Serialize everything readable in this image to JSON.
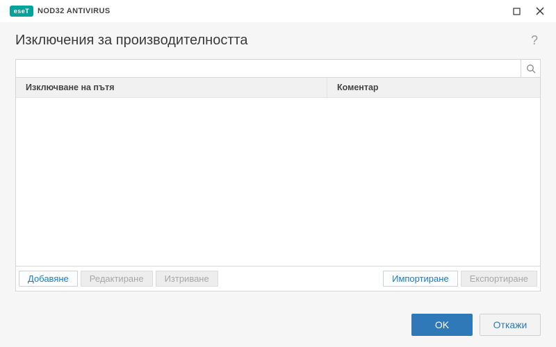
{
  "titlebar": {
    "logo_text": "eseT",
    "app_name": "NOD32 ANTIVIRUS"
  },
  "header": {
    "title": "Изключения за производителността"
  },
  "search": {
    "placeholder": ""
  },
  "table": {
    "columns": {
      "path": "Изключване на пътя",
      "comment": "Коментар"
    },
    "rows": []
  },
  "toolbar": {
    "add": "Добавяне",
    "edit": "Редактиране",
    "delete": "Изтриване",
    "import": "Импортиране",
    "export": "Експортиране"
  },
  "footer": {
    "ok": "OK",
    "cancel": "Откажи"
  }
}
